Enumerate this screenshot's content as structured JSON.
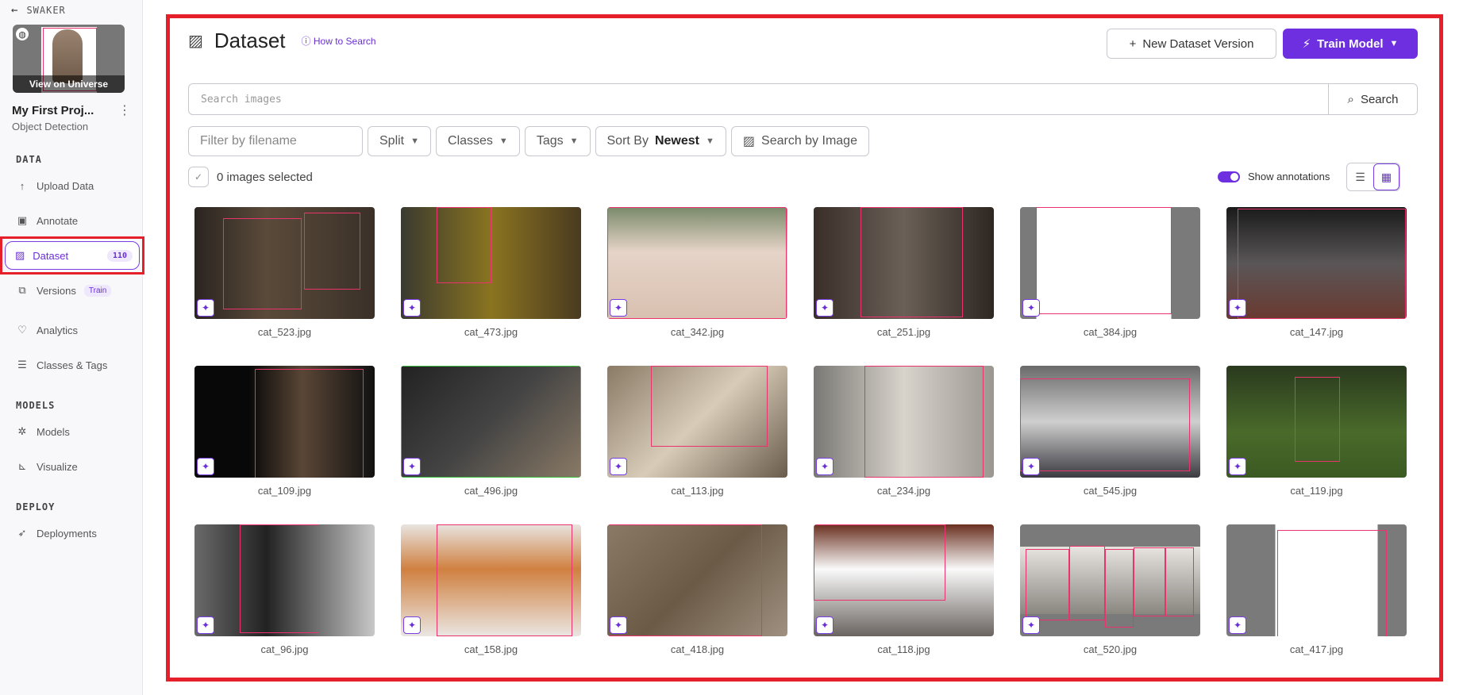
{
  "sidebar": {
    "workspace": "SWAKER",
    "thumbnail_label": "View on Universe",
    "project_name": "My First Proj...",
    "project_type": "Object Detection",
    "sections": {
      "data": "DATA",
      "models": "MODELS",
      "deploy": "DEPLOY"
    },
    "items": {
      "upload": "Upload Data",
      "annotate": "Annotate",
      "dataset": "Dataset",
      "dataset_count": "110",
      "versions": "Versions",
      "versions_badge": "Train",
      "analytics": "Analytics",
      "classes": "Classes & Tags",
      "models": "Models",
      "visualize": "Visualize",
      "deployments": "Deployments"
    }
  },
  "header": {
    "title": "Dataset",
    "how_to": "How to Search",
    "new_version": "New Dataset Version",
    "train_model": "Train Model"
  },
  "search": {
    "placeholder": "Search images",
    "button": "Search"
  },
  "filters": {
    "filename_placeholder": "Filter by filename",
    "split": "Split",
    "classes": "Classes",
    "tags": "Tags",
    "sort_label": "Sort By",
    "sort_value": "Newest",
    "search_by_image": "Search by Image"
  },
  "selection": {
    "selected": "0 images selected",
    "show_annotations": "Show annotations"
  },
  "colors": {
    "accent": "#6e2fe0",
    "bbox": "#e8336d",
    "highlight": "#e5202a"
  },
  "images": [
    {
      "name": "cat_523.jpg",
      "bg": "linear-gradient(90deg,#2a2420,#5a4a3a 40%,#3a3028)"
    },
    {
      "name": "cat_473.jpg",
      "bg": "linear-gradient(90deg,#3a3a30,#8a7420 50%,#4a3a20)"
    },
    {
      "name": "cat_342.jpg",
      "bg": "linear-gradient(180deg,#7a8a6a,#e6d4c8 40%,#d8c0b0)"
    },
    {
      "name": "cat_251.jpg",
      "bg": "linear-gradient(90deg,#3a2e28,#6a6058 50%,#2e2620)"
    },
    {
      "name": "cat_384.jpg",
      "bg": "linear-gradient(90deg,#7a7a7a 9%,#fff 9%,#fff 84%,#7a7a7a 84%)"
    },
    {
      "name": "cat_147.jpg",
      "bg": "linear-gradient(180deg,#1a1a1a,#5a5658 50%,#6a3a30)"
    },
    {
      "name": "cat_109.jpg",
      "bg": "linear-gradient(90deg,#080808 30%,#5a4636 60%,#111)"
    },
    {
      "name": "cat_496.jpg",
      "bg": "linear-gradient(135deg,#222,#444 50%,#8a7a66)"
    },
    {
      "name": "cat_113.jpg",
      "bg": "linear-gradient(135deg,#8a7a66,#d8ccb8 50%,#6a5c4c)"
    },
    {
      "name": "cat_234.jpg",
      "bg": "linear-gradient(90deg,#7a7874,#d8d4cc 50%,#9a9690)"
    },
    {
      "name": "cat_545.jpg",
      "bg": "linear-gradient(180deg,#6a6a6a,#cfcfcf 50%,#3a3a40)"
    },
    {
      "name": "cat_119.jpg",
      "bg": "linear-gradient(180deg,#2a3a1e,#4a6a2a 60%,#3a5a22)"
    },
    {
      "name": "cat_96.jpg",
      "bg": "linear-gradient(90deg,#6a6a6a,#222 40%,#c8c8c8)"
    },
    {
      "name": "cat_158.jpg",
      "bg": "linear-gradient(180deg,#e8e4e0,#d08040 40%,#eae6e2)"
    },
    {
      "name": "cat_418.jpg",
      "bg": "linear-gradient(135deg,#8a7a66,#6a5a46 50%,#a09080)"
    },
    {
      "name": "cat_118.jpg",
      "bg": "linear-gradient(180deg,#6a3020,#fafafa 40%,#6a6460)"
    },
    {
      "name": "cat_520.jpg",
      "bg": "linear-gradient(180deg,#7a7a7a 20%,#e8e4e0 20%,#8a8680 80%,#7a7a7a 80%)"
    },
    {
      "name": "cat_417.jpg",
      "bg": "linear-gradient(90deg,#7a7a7a 27%,#fff 27%,#fff 84%,#7a7a7a 84%)"
    }
  ]
}
